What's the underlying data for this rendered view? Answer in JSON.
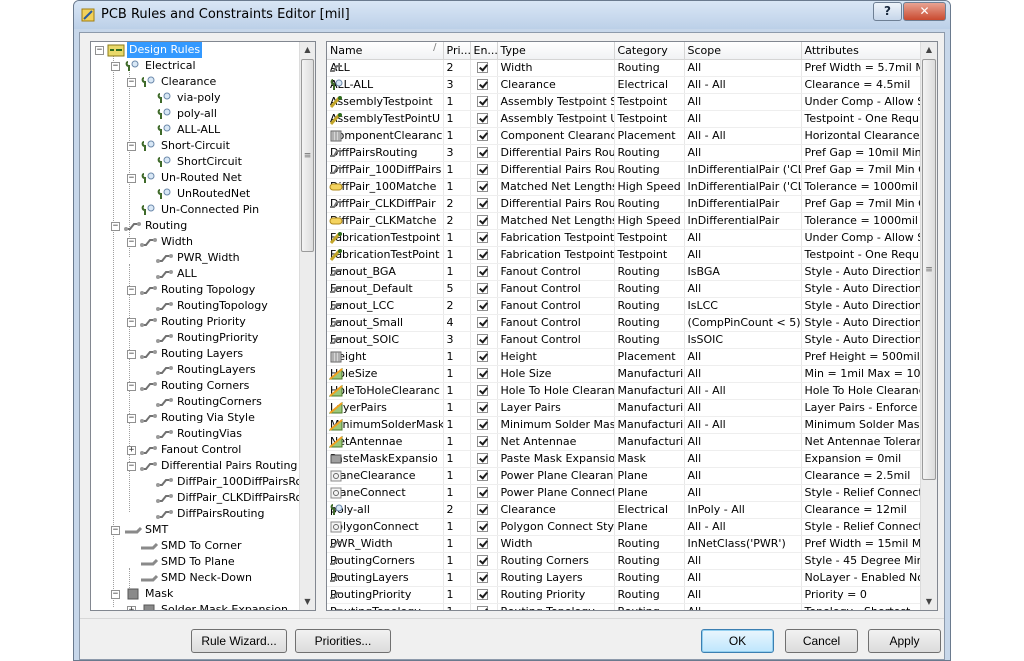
{
  "window": {
    "title": "PCB Rules and Constraints Editor [mil]",
    "help": "?",
    "close": "✕"
  },
  "tree": {
    "nodes": [
      {
        "label": "Design Rules",
        "level": 0,
        "exp": "−",
        "icon": "design-rules",
        "selected": true
      },
      {
        "label": "Electrical",
        "level": 1,
        "exp": "−",
        "icon": "rule-category"
      },
      {
        "label": "Clearance",
        "level": 2,
        "exp": "−",
        "icon": "rule-type"
      },
      {
        "label": "via-poly",
        "level": 3,
        "icon": "rule"
      },
      {
        "label": "poly-all",
        "level": 3,
        "icon": "rule"
      },
      {
        "label": "ALL-ALL",
        "level": 3,
        "icon": "rule"
      },
      {
        "label": "Short-Circuit",
        "level": 2,
        "exp": "−",
        "icon": "rule-type"
      },
      {
        "label": "ShortCircuit",
        "level": 3,
        "icon": "rule"
      },
      {
        "label": "Un-Routed Net",
        "level": 2,
        "exp": "−",
        "icon": "rule-type"
      },
      {
        "label": "UnRoutedNet",
        "level": 3,
        "icon": "rule"
      },
      {
        "label": "Un-Connected Pin",
        "level": 2,
        "icon": "rule-type"
      },
      {
        "label": "Routing",
        "level": 1,
        "exp": "−",
        "icon": "routing-category"
      },
      {
        "label": "Width",
        "level": 2,
        "exp": "−",
        "icon": "routing-type"
      },
      {
        "label": "PWR_Width",
        "level": 3,
        "icon": "routing-rule"
      },
      {
        "label": "ALL",
        "level": 3,
        "icon": "routing-rule"
      },
      {
        "label": "Routing Topology",
        "level": 2,
        "exp": "−",
        "icon": "routing-type"
      },
      {
        "label": "RoutingTopology",
        "level": 3,
        "icon": "routing-rule"
      },
      {
        "label": "Routing Priority",
        "level": 2,
        "exp": "−",
        "icon": "routing-type"
      },
      {
        "label": "RoutingPriority",
        "level": 3,
        "icon": "routing-rule"
      },
      {
        "label": "Routing Layers",
        "level": 2,
        "exp": "−",
        "icon": "routing-type"
      },
      {
        "label": "RoutingLayers",
        "level": 3,
        "icon": "routing-rule"
      },
      {
        "label": "Routing Corners",
        "level": 2,
        "exp": "−",
        "icon": "routing-type"
      },
      {
        "label": "RoutingCorners",
        "level": 3,
        "icon": "routing-rule"
      },
      {
        "label": "Routing Via Style",
        "level": 2,
        "exp": "−",
        "icon": "routing-type"
      },
      {
        "label": "RoutingVias",
        "level": 3,
        "icon": "routing-rule"
      },
      {
        "label": "Fanout Control",
        "level": 2,
        "exp": "+",
        "icon": "routing-type"
      },
      {
        "label": "Differential Pairs Routing",
        "level": 2,
        "exp": "−",
        "icon": "routing-type"
      },
      {
        "label": "DiffPair_100DiffPairsRouting",
        "level": 3,
        "icon": "routing-rule"
      },
      {
        "label": "DiffPair_CLKDiffPairsRouting",
        "level": 3,
        "icon": "routing-rule"
      },
      {
        "label": "DiffPairsRouting",
        "level": 3,
        "icon": "routing-rule"
      },
      {
        "label": "SMT",
        "level": 1,
        "exp": "−",
        "icon": "smt-category"
      },
      {
        "label": "SMD To Corner",
        "level": 2,
        "icon": "smt-type"
      },
      {
        "label": "SMD To Plane",
        "level": 2,
        "icon": "smt-type"
      },
      {
        "label": "SMD Neck-Down",
        "level": 2,
        "icon": "smt-type"
      },
      {
        "label": "Mask",
        "level": 1,
        "exp": "−",
        "icon": "mask-category"
      },
      {
        "label": "Solder Mask Expansion",
        "level": 2,
        "exp": "+",
        "icon": "mask-type"
      }
    ]
  },
  "grid": {
    "columns": [
      "Name",
      "Pri...",
      "En...",
      "Type",
      "Category",
      "Scope",
      "Attributes"
    ],
    "rows": [
      {
        "icon": "routing",
        "name": "ALL",
        "pri": "2",
        "type": "Width",
        "cat": "Routing",
        "scope": "All",
        "attr": "Pref Width = 5.7mil   Mi"
      },
      {
        "icon": "electrical",
        "name": "ALL-ALL",
        "pri": "3",
        "type": "Clearance",
        "cat": "Electrical",
        "scope": "All   -   All",
        "attr": "Clearance = 4.5mil"
      },
      {
        "icon": "testpoint",
        "name": "AssemblyTestpoint",
        "pri": "1",
        "type": "Assembly Testpoint Styl",
        "cat": "Testpoint",
        "scope": "All",
        "attr": "Under Comp - Allow   S"
      },
      {
        "icon": "testpoint",
        "name": "AssemblyTestPointU",
        "pri": "1",
        "type": "Assembly Testpoint Usa",
        "cat": "Testpoint",
        "scope": "All",
        "attr": "Testpoint - One Require"
      },
      {
        "icon": "placement",
        "name": "ComponentClearanc",
        "pri": "1",
        "type": "Component Clearance",
        "cat": "Placement",
        "scope": "All   -   All",
        "attr": "Horizontal Clearance = "
      },
      {
        "icon": "routing",
        "name": "DiffPairsRouting",
        "pri": "3",
        "type": "Differential Pairs Routin",
        "cat": "Routing",
        "scope": "All",
        "attr": "Pref Gap = 10mil   Min G"
      },
      {
        "icon": "routing",
        "name": "DiffPair_100DiffPairs",
        "pri": "1",
        "type": "Differential Pairs Routin",
        "cat": "Routing",
        "scope": "InDifferentialPair ('CLK')",
        "attr": "Pref Gap = 7mil   Min G"
      },
      {
        "icon": "highspeed",
        "name": "DiffPair_100Matche",
        "pri": "1",
        "type": "Matched Net Lengths",
        "cat": "High Speed",
        "scope": "InDifferentialPair ('CLK')",
        "attr": "Tolerance = 1000mil"
      },
      {
        "icon": "routing",
        "name": "DiffPair_CLKDiffPair",
        "pri": "2",
        "type": "Differential Pairs Routin",
        "cat": "Routing",
        "scope": "InDifferentialPair",
        "attr": "Pref Gap = 7mil   Min G"
      },
      {
        "icon": "highspeed",
        "name": "DiffPair_CLKMatche",
        "pri": "2",
        "type": "Matched Net Lengths",
        "cat": "High Speed",
        "scope": "InDifferentialPair",
        "attr": "Tolerance = 1000mil"
      },
      {
        "icon": "testpoint",
        "name": "FabricationTestpoint",
        "pri": "1",
        "type": "Fabrication Testpoint St",
        "cat": "Testpoint",
        "scope": "All",
        "attr": "Under Comp - Allow   S"
      },
      {
        "icon": "testpoint",
        "name": "FabricationTestPoint",
        "pri": "1",
        "type": "Fabrication Testpoint U:",
        "cat": "Testpoint",
        "scope": "All",
        "attr": "Testpoint - One Require"
      },
      {
        "icon": "routing",
        "name": "Fanout_BGA",
        "pri": "1",
        "type": "Fanout Control",
        "cat": "Routing",
        "scope": "IsBGA",
        "attr": "Style - Auto   Direction"
      },
      {
        "icon": "routing",
        "name": "Fanout_Default",
        "pri": "5",
        "type": "Fanout Control",
        "cat": "Routing",
        "scope": "All",
        "attr": "Style - Auto   Direction"
      },
      {
        "icon": "routing",
        "name": "Fanout_LCC",
        "pri": "2",
        "type": "Fanout Control",
        "cat": "Routing",
        "scope": "IsLCC",
        "attr": "Style - Auto   Direction"
      },
      {
        "icon": "routing",
        "name": "Fanout_Small",
        "pri": "4",
        "type": "Fanout Control",
        "cat": "Routing",
        "scope": "(CompPinCount < 5)",
        "attr": "Style - Auto   Direction"
      },
      {
        "icon": "routing",
        "name": "Fanout_SOIC",
        "pri": "3",
        "type": "Fanout Control",
        "cat": "Routing",
        "scope": "IsSOIC",
        "attr": "Style - Auto   Direction"
      },
      {
        "icon": "placement",
        "name": "Height",
        "pri": "1",
        "type": "Height",
        "cat": "Placement",
        "scope": "All",
        "attr": "Pref Height = 500mil   M"
      },
      {
        "icon": "manufacturing",
        "name": "HoleSize",
        "pri": "1",
        "type": "Hole Size",
        "cat": "Manufacturing",
        "scope": "All",
        "attr": "Min = 1mil   Max = 100r"
      },
      {
        "icon": "manufacturing",
        "name": "HoleToHoleClearanc",
        "pri": "1",
        "type": "Hole To Hole Clearance",
        "cat": "Manufacturing",
        "scope": "All   -   All",
        "attr": "Hole To Hole Clearance"
      },
      {
        "icon": "manufacturing",
        "name": "LayerPairs",
        "pri": "1",
        "type": "Layer Pairs",
        "cat": "Manufacturing",
        "scope": "All",
        "attr": "Layer Pairs - Enforce"
      },
      {
        "icon": "manufacturing",
        "name": "MinimumSolderMask",
        "pri": "1",
        "type": "Minimum Solder Mask S",
        "cat": "Manufacturing",
        "scope": "All   -   All",
        "attr": "Minimum Solder Mask S"
      },
      {
        "icon": "manufacturing",
        "name": "NetAntennae",
        "pri": "1",
        "type": "Net Antennae",
        "cat": "Manufacturing",
        "scope": "All",
        "attr": "Net Antennae Toleranc"
      },
      {
        "icon": "mask",
        "name": "PasteMaskExpansio",
        "pri": "1",
        "type": "Paste Mask Expansion",
        "cat": "Mask",
        "scope": "All",
        "attr": "Expansion = 0mil"
      },
      {
        "icon": "plane",
        "name": "PlaneClearance",
        "pri": "1",
        "type": "Power Plane Clearance",
        "cat": "Plane",
        "scope": "All",
        "attr": "Clearance = 2.5mil"
      },
      {
        "icon": "plane",
        "name": "PlaneConnect",
        "pri": "1",
        "type": "Power Plane Connect S",
        "cat": "Plane",
        "scope": "All",
        "attr": "Style - Relief Connect"
      },
      {
        "icon": "electrical",
        "name": "poly-all",
        "pri": "2",
        "type": "Clearance",
        "cat": "Electrical",
        "scope": "InPoly   -   All",
        "attr": "Clearance = 12mil"
      },
      {
        "icon": "plane",
        "name": "PolygonConnect",
        "pri": "1",
        "type": "Polygon Connect Style",
        "cat": "Plane",
        "scope": "All   -   All",
        "attr": "Style - Relief Connect"
      },
      {
        "icon": "routing",
        "name": "PWR_Width",
        "pri": "1",
        "type": "Width",
        "cat": "Routing",
        "scope": "InNetClass('PWR')",
        "attr": "Pref Width = 15mil   Mir"
      },
      {
        "icon": "routing",
        "name": "RoutingCorners",
        "pri": "1",
        "type": "Routing Corners",
        "cat": "Routing",
        "scope": "All",
        "attr": "Style - 45 Degree   Min"
      },
      {
        "icon": "routing",
        "name": "RoutingLayers",
        "pri": "1",
        "type": "Routing Layers",
        "cat": "Routing",
        "scope": "All",
        "attr": "NoLayer - Enabled NoL"
      },
      {
        "icon": "routing",
        "name": "RoutingPriority",
        "pri": "1",
        "type": "Routing Priority",
        "cat": "Routing",
        "scope": "All",
        "attr": "Priority = 0"
      },
      {
        "icon": "routing",
        "name": "RoutingTopology",
        "pri": "1",
        "type": "Routing Topology",
        "cat": "Routing",
        "scope": "All",
        "attr": "Topology - Shortest"
      }
    ]
  },
  "buttons": {
    "rule_wizard": "Rule Wizard...",
    "priorities": "Priorities...",
    "ok": "OK",
    "cancel": "Cancel",
    "apply": "Apply"
  },
  "colors": {
    "selection": "#3399ff",
    "titlebar": "#c7d7ea",
    "close": "#c94a2f"
  }
}
